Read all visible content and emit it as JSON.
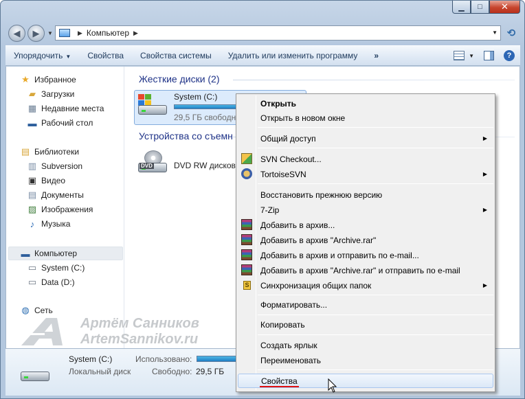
{
  "window": {
    "min_label": "▁",
    "max_label": "□",
    "close_label": "✕"
  },
  "address": {
    "path": "Компьютер"
  },
  "toolbar": {
    "organize": "Упорядочить",
    "properties": "Свойства",
    "system_properties": "Свойства системы",
    "uninstall": "Удалить или изменить программу",
    "more": "»"
  },
  "sidebar": {
    "favorites": "Избранное",
    "downloads": "Загрузки",
    "recent": "Недавние места",
    "desktop": "Рабочий стол",
    "libraries": "Библиотеки",
    "subversion": "Subversion",
    "video": "Видео",
    "documents": "Документы",
    "images": "Изображения",
    "music": "Музыка",
    "computer": "Компьютер",
    "system_c": "System (C:)",
    "data_d": "Data (D:)",
    "network": "Сеть"
  },
  "main": {
    "hard_disks_title": "Жесткие диски (2)",
    "drive_c_name": "System (C:)",
    "drive_c_free": "29,5 ГБ свободно",
    "removable_title": "Устройства со съемн",
    "dvd_name": "DVD RW дисково",
    "dvd_label": "DVD",
    "drive_c_used_fraction": 0.75
  },
  "context_menu": {
    "open": "Открыть",
    "open_new_window": "Открыть в новом окне",
    "share": "Общий доступ",
    "svn_checkout": "SVN Checkout...",
    "tortoise": "TortoiseSVN",
    "restore_prev": "Восстановить прежнюю версию",
    "zip7": "7-Zip",
    "add_archive": "Добавить в архив...",
    "add_archive_rar": "Добавить в архив \"Archive.rar\"",
    "add_archive_email": "Добавить в архив и отправить по e-mail...",
    "add_archive_rar_email": "Добавить в архив \"Archive.rar\" и отправить по e-mail",
    "sync": "Синхронизация общих папок",
    "format": "Форматировать...",
    "copy": "Копировать",
    "create_shortcut": "Создать ярлык",
    "rename": "Переименовать",
    "properties": "Свойства"
  },
  "watermark": {
    "line1": "Артём Санников",
    "line2": "ArtemSannikov.ru"
  },
  "details": {
    "name": "System (C:)",
    "type": "Локальный диск",
    "used_label": "Использовано:",
    "free_label": "Свободно:",
    "free_value": "29,5 ГБ"
  },
  "colors": {
    "accent": "#1e3287",
    "highlight_red": "#e01010",
    "selection": "#dcebfc"
  }
}
